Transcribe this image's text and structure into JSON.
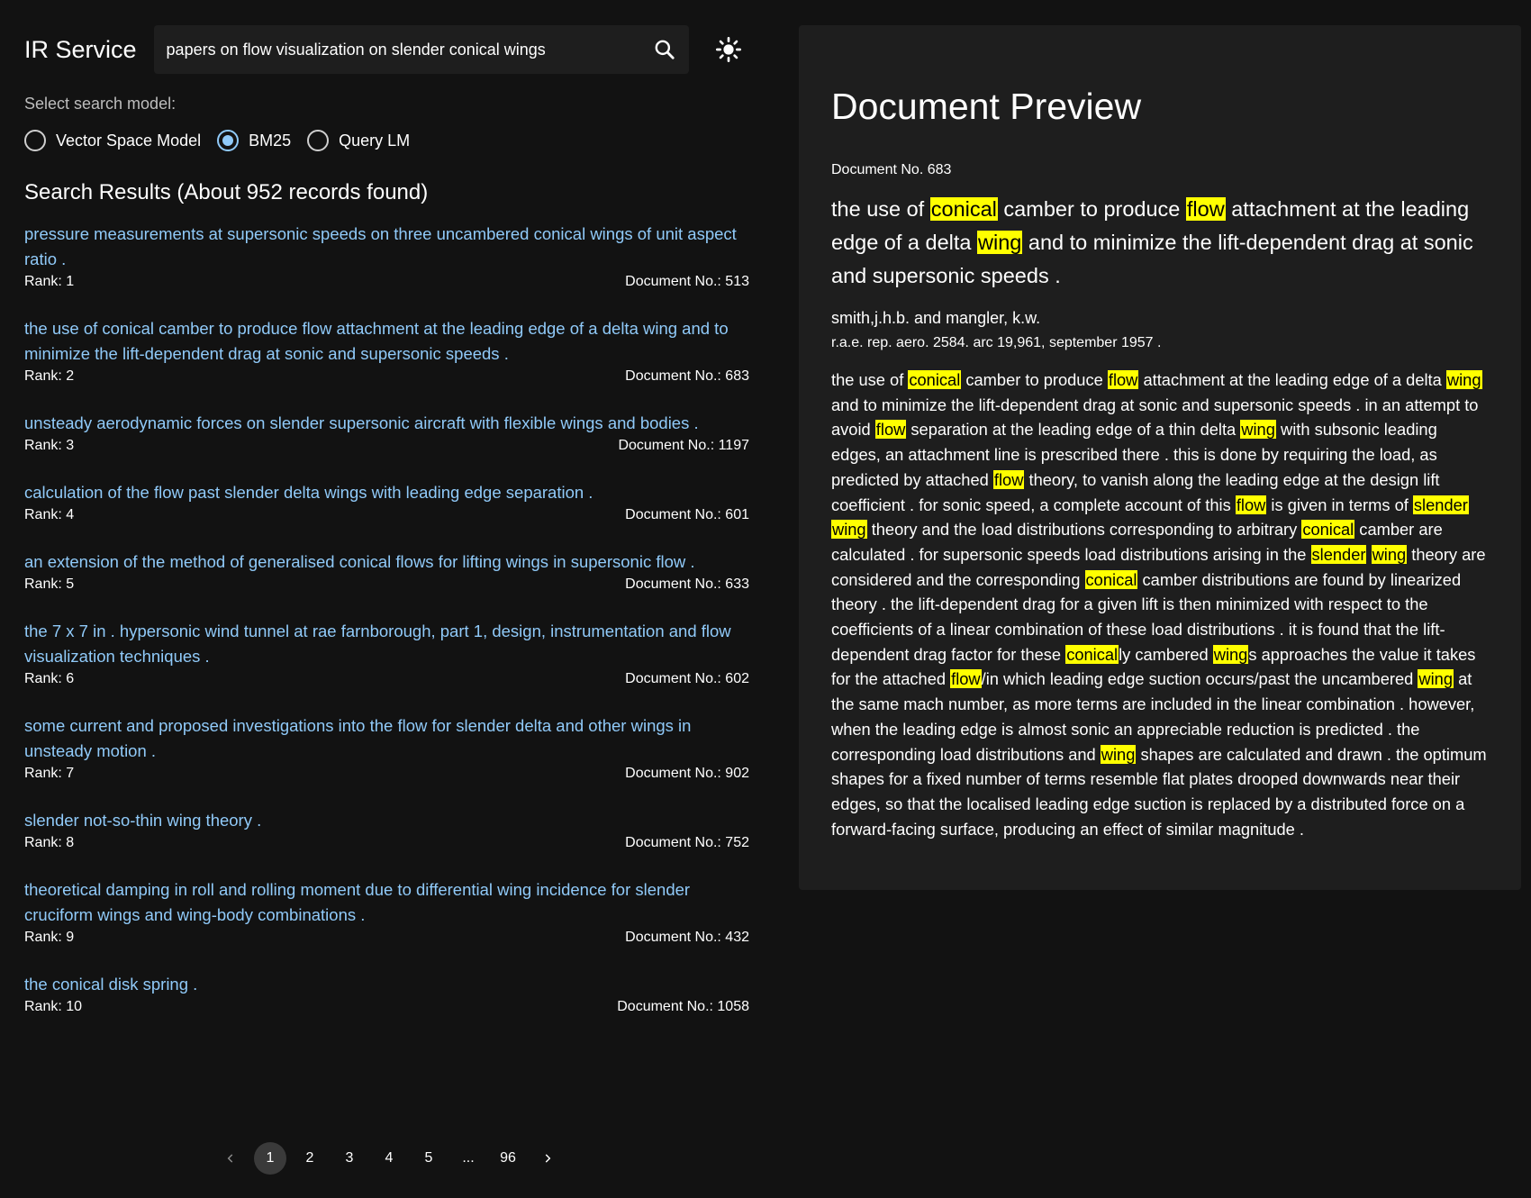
{
  "header": {
    "app_title": "IR Service",
    "search_value": "papers on flow visualization on slender conical wings"
  },
  "model_selector": {
    "label": "Select search model:",
    "options": [
      {
        "label": "Vector Space Model",
        "selected": false
      },
      {
        "label": "BM25",
        "selected": true
      },
      {
        "label": "Query LM",
        "selected": false
      }
    ]
  },
  "results": {
    "heading": "Search Results (About 952 records found)",
    "items": [
      {
        "title": "pressure measurements at supersonic speeds on three uncambered conical wings of unit aspect ratio .",
        "rank": "Rank: 1",
        "doc": "Document No.: 513"
      },
      {
        "title": "the use of conical camber to produce flow attachment at the leading edge of a delta wing and to minimize the lift-dependent drag at sonic and supersonic speeds .",
        "rank": "Rank: 2",
        "doc": "Document No.: 683"
      },
      {
        "title": "unsteady aerodynamic forces on slender supersonic aircraft with flexible wings and bodies .",
        "rank": "Rank: 3",
        "doc": "Document No.: 1197"
      },
      {
        "title": "calculation of the flow past slender delta wings with leading edge separation .",
        "rank": "Rank: 4",
        "doc": "Document No.: 601"
      },
      {
        "title": "an extension of the method of generalised conical flows for lifting wings in supersonic flow .",
        "rank": "Rank: 5",
        "doc": "Document No.: 633"
      },
      {
        "title": "the 7 x 7 in . hypersonic wind tunnel at rae farnborough, part 1, design, instrumentation and flow visualization techniques .",
        "rank": "Rank: 6",
        "doc": "Document No.: 602"
      },
      {
        "title": "some current and proposed investigations into the flow for slender delta and other wings in unsteady motion .",
        "rank": "Rank: 7",
        "doc": "Document No.: 902"
      },
      {
        "title": "slender not-so-thin wing theory .",
        "rank": "Rank: 8",
        "doc": "Document No.: 752"
      },
      {
        "title": "theoretical damping in roll and rolling moment due to differential wing incidence for slender cruciform wings and wing-body combinations .",
        "rank": "Rank: 9",
        "doc": "Document No.: 432"
      },
      {
        "title": "the conical disk spring .",
        "rank": "Rank: 10",
        "doc": "Document No.: 1058"
      }
    ]
  },
  "pagination": {
    "prev_icon": "chevron-left-icon",
    "next_icon": "chevron-right-icon",
    "pages": [
      "1",
      "2",
      "3",
      "4",
      "5",
      "...",
      "96"
    ],
    "current": "1"
  },
  "preview": {
    "title": "Document Preview",
    "doc_number": "Document No. 683",
    "heading_text": "the use of conical camber to produce flow attachment at the leading edge of a delta wing and to minimize the lift-dependent drag at sonic and supersonic speeds .",
    "authors": "smith,j.h.b. and mangler, k.w.",
    "citation": "r.a.e. rep. aero. 2584. arc 19,961, september 1957 .",
    "body_text": "the use of conical camber to produce flow attachment at the leading edge of a delta wing and to minimize the lift-dependent drag at sonic and supersonic speeds . in an attempt to avoid flow separation at the leading edge of a thin delta wing with subsonic leading edges, an attachment line is prescribed there . this is done by requiring the load, as predicted by attached flow theory, to vanish along the leading edge at the design lift coefficient . for sonic speed, a complete account of this flow is given in terms of slender wing theory and the load distributions corresponding to arbitrary conical camber are calculated . for supersonic speeds load distributions arising in the slender wing theory are considered and the corresponding conical camber distributions are found by linearized theory . the lift-dependent drag for a given lift is then minimized with respect to the coefficients of a linear combination of these load distributions . it is found that the lift-dependent drag factor for these conically cambered wings approaches the value it takes for the attached flow/in which leading edge suction occurs/past the uncambered wing at the same mach number, as more terms are included in the linear combination . however, when the leading edge is almost sonic an appreciable reduction is predicted . the corresponding load distributions and wing shapes are calculated and drawn . the optimum shapes for a fixed number of terms resemble flat plates drooped downwards near their edges, so that the localised leading edge suction is replaced by a distributed force on a forward-facing surface, producing an effect of similar magnitude .",
    "highlight_terms": [
      "conical",
      "flow",
      "wing",
      "slender"
    ],
    "highlight_color": "#ffff00"
  },
  "colors": {
    "background": "#121212",
    "panel": "#1e1e1e",
    "link": "#90caf9"
  }
}
